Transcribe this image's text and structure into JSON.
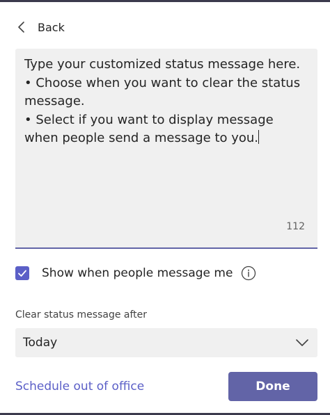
{
  "nav": {
    "back_label": "Back"
  },
  "editor": {
    "lines": [
      "Type your customized status message here.",
      "• Choose when you want to clear the status message.",
      "• Select if you want to display message when people send a message to you."
    ],
    "counter": "112"
  },
  "show_when_message": {
    "label": "Show when people message me",
    "checked": true
  },
  "clear_after": {
    "label": "Clear status message after",
    "value": "Today"
  },
  "footer": {
    "schedule_link": "Schedule out of office",
    "done_label": "Done"
  },
  "colors": {
    "accent": "#6264a7",
    "link": "#5b5fc7",
    "field_bg": "#f0f0f0"
  }
}
